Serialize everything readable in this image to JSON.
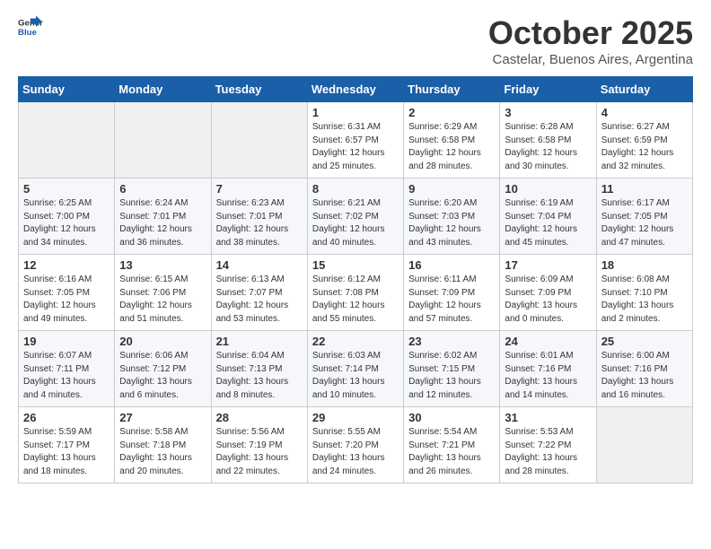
{
  "logo": {
    "general": "General",
    "blue": "Blue"
  },
  "header": {
    "month": "October 2025",
    "location": "Castelar, Buenos Aires, Argentina"
  },
  "days_of_week": [
    "Sunday",
    "Monday",
    "Tuesday",
    "Wednesday",
    "Thursday",
    "Friday",
    "Saturday"
  ],
  "weeks": [
    [
      {
        "day": "",
        "info": ""
      },
      {
        "day": "",
        "info": ""
      },
      {
        "day": "",
        "info": ""
      },
      {
        "day": "1",
        "info": "Sunrise: 6:31 AM\nSunset: 6:57 PM\nDaylight: 12 hours\nand 25 minutes."
      },
      {
        "day": "2",
        "info": "Sunrise: 6:29 AM\nSunset: 6:58 PM\nDaylight: 12 hours\nand 28 minutes."
      },
      {
        "day": "3",
        "info": "Sunrise: 6:28 AM\nSunset: 6:58 PM\nDaylight: 12 hours\nand 30 minutes."
      },
      {
        "day": "4",
        "info": "Sunrise: 6:27 AM\nSunset: 6:59 PM\nDaylight: 12 hours\nand 32 minutes."
      }
    ],
    [
      {
        "day": "5",
        "info": "Sunrise: 6:25 AM\nSunset: 7:00 PM\nDaylight: 12 hours\nand 34 minutes."
      },
      {
        "day": "6",
        "info": "Sunrise: 6:24 AM\nSunset: 7:01 PM\nDaylight: 12 hours\nand 36 minutes."
      },
      {
        "day": "7",
        "info": "Sunrise: 6:23 AM\nSunset: 7:01 PM\nDaylight: 12 hours\nand 38 minutes."
      },
      {
        "day": "8",
        "info": "Sunrise: 6:21 AM\nSunset: 7:02 PM\nDaylight: 12 hours\nand 40 minutes."
      },
      {
        "day": "9",
        "info": "Sunrise: 6:20 AM\nSunset: 7:03 PM\nDaylight: 12 hours\nand 43 minutes."
      },
      {
        "day": "10",
        "info": "Sunrise: 6:19 AM\nSunset: 7:04 PM\nDaylight: 12 hours\nand 45 minutes."
      },
      {
        "day": "11",
        "info": "Sunrise: 6:17 AM\nSunset: 7:05 PM\nDaylight: 12 hours\nand 47 minutes."
      }
    ],
    [
      {
        "day": "12",
        "info": "Sunrise: 6:16 AM\nSunset: 7:05 PM\nDaylight: 12 hours\nand 49 minutes."
      },
      {
        "day": "13",
        "info": "Sunrise: 6:15 AM\nSunset: 7:06 PM\nDaylight: 12 hours\nand 51 minutes."
      },
      {
        "day": "14",
        "info": "Sunrise: 6:13 AM\nSunset: 7:07 PM\nDaylight: 12 hours\nand 53 minutes."
      },
      {
        "day": "15",
        "info": "Sunrise: 6:12 AM\nSunset: 7:08 PM\nDaylight: 12 hours\nand 55 minutes."
      },
      {
        "day": "16",
        "info": "Sunrise: 6:11 AM\nSunset: 7:09 PM\nDaylight: 12 hours\nand 57 minutes."
      },
      {
        "day": "17",
        "info": "Sunrise: 6:09 AM\nSunset: 7:09 PM\nDaylight: 13 hours\nand 0 minutes."
      },
      {
        "day": "18",
        "info": "Sunrise: 6:08 AM\nSunset: 7:10 PM\nDaylight: 13 hours\nand 2 minutes."
      }
    ],
    [
      {
        "day": "19",
        "info": "Sunrise: 6:07 AM\nSunset: 7:11 PM\nDaylight: 13 hours\nand 4 minutes."
      },
      {
        "day": "20",
        "info": "Sunrise: 6:06 AM\nSunset: 7:12 PM\nDaylight: 13 hours\nand 6 minutes."
      },
      {
        "day": "21",
        "info": "Sunrise: 6:04 AM\nSunset: 7:13 PM\nDaylight: 13 hours\nand 8 minutes."
      },
      {
        "day": "22",
        "info": "Sunrise: 6:03 AM\nSunset: 7:14 PM\nDaylight: 13 hours\nand 10 minutes."
      },
      {
        "day": "23",
        "info": "Sunrise: 6:02 AM\nSunset: 7:15 PM\nDaylight: 13 hours\nand 12 minutes."
      },
      {
        "day": "24",
        "info": "Sunrise: 6:01 AM\nSunset: 7:16 PM\nDaylight: 13 hours\nand 14 minutes."
      },
      {
        "day": "25",
        "info": "Sunrise: 6:00 AM\nSunset: 7:16 PM\nDaylight: 13 hours\nand 16 minutes."
      }
    ],
    [
      {
        "day": "26",
        "info": "Sunrise: 5:59 AM\nSunset: 7:17 PM\nDaylight: 13 hours\nand 18 minutes."
      },
      {
        "day": "27",
        "info": "Sunrise: 5:58 AM\nSunset: 7:18 PM\nDaylight: 13 hours\nand 20 minutes."
      },
      {
        "day": "28",
        "info": "Sunrise: 5:56 AM\nSunset: 7:19 PM\nDaylight: 13 hours\nand 22 minutes."
      },
      {
        "day": "29",
        "info": "Sunrise: 5:55 AM\nSunset: 7:20 PM\nDaylight: 13 hours\nand 24 minutes."
      },
      {
        "day": "30",
        "info": "Sunrise: 5:54 AM\nSunset: 7:21 PM\nDaylight: 13 hours\nand 26 minutes."
      },
      {
        "day": "31",
        "info": "Sunrise: 5:53 AM\nSunset: 7:22 PM\nDaylight: 13 hours\nand 28 minutes."
      },
      {
        "day": "",
        "info": ""
      }
    ]
  ]
}
